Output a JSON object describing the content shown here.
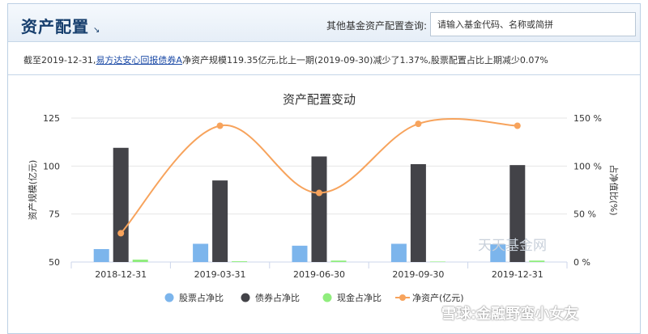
{
  "header": {
    "title": "资产配置",
    "title_arrow": "↘",
    "query_label": "其他基金资产配置查询:",
    "search_placeholder": "请输入基金代码、名称或简拼"
  },
  "summary": {
    "prefix": "截至2019-12-31,",
    "fund_name": "易方达安心回报债券A",
    "suffix": "净资产规模119.35亿元,比上一期(2019-09-30)减少了1.37%,股票配置占比上期减少0.07%"
  },
  "watermarks": {
    "site": "天天基金网",
    "xueqiu": "雪球:金融野蛮小女友"
  },
  "colors": {
    "stock": "#7cb5ec",
    "bond": "#434348",
    "cash": "#90ed7d",
    "net_assets": "#f7a35c",
    "header_title": "#163e6d"
  },
  "chart_data": {
    "type": "bar",
    "title": "资产配置变动",
    "categories": [
      "2018-12-31",
      "2019-03-31",
      "2019-06-30",
      "2019-09-30",
      "2019-12-31"
    ],
    "series": [
      {
        "name": "股票占净比",
        "type": "bar",
        "axis": "right",
        "values": [
          13.5,
          19,
          17,
          19,
          18.5
        ]
      },
      {
        "name": "债券占净比",
        "type": "bar",
        "axis": "right",
        "values": [
          119,
          85,
          110,
          102,
          101
        ]
      },
      {
        "name": "现金占净比",
        "type": "bar",
        "axis": "right",
        "values": [
          2.5,
          0.8,
          1.5,
          0.5,
          1.5
        ]
      },
      {
        "name": "净资产(亿元)",
        "type": "line",
        "axis": "left",
        "values": [
          65,
          121,
          86,
          122,
          121
        ]
      }
    ],
    "y_left": {
      "label": "资产规模(亿元)",
      "ylim": [
        50,
        125
      ],
      "ticks": [
        "50",
        "75",
        "100",
        "125"
      ]
    },
    "y_right": {
      "label": "占净值比(%)",
      "ylim": [
        0,
        150
      ],
      "ticks": [
        "0 %",
        "50 %",
        "100 %",
        "150 %"
      ]
    },
    "grid": true,
    "legend_placement": "bottom"
  }
}
